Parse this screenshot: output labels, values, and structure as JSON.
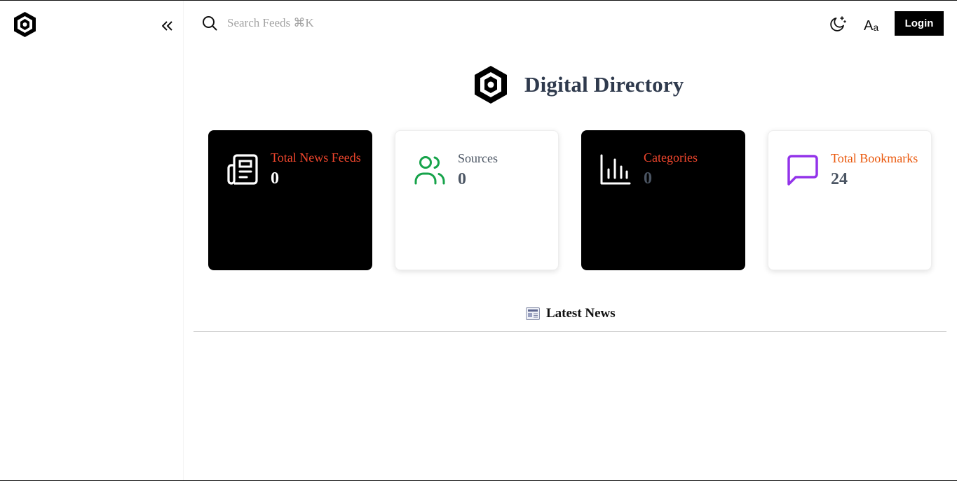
{
  "search": {
    "placeholder": "Search Feeds ⌘K"
  },
  "header": {
    "theme_icon": "moon-sparkle-icon",
    "font_icon": "font-size-icon",
    "font_big": "A",
    "font_small": "a",
    "login_label": "Login"
  },
  "brand": {
    "title": "Digital Directory"
  },
  "stats": [
    {
      "label": "Total News Feeds",
      "value": "0",
      "icon": "newspaper-icon",
      "bg": "#000000",
      "label_color": "#f0462d",
      "value_color": "#ffffff",
      "icon_color": "#ffffff"
    },
    {
      "label": "Sources",
      "value": "0",
      "icon": "users-icon",
      "bg": "#ffffff",
      "label_color": "#4b5563",
      "value_color": "#4b5563",
      "icon_color": "#16a34a"
    },
    {
      "label": "Categories",
      "value": "0",
      "icon": "bar-chart-icon",
      "bg": "#000000",
      "label_color": "#f0462d",
      "value_color": "#4b5563",
      "icon_color": "#ffffff"
    },
    {
      "label": "Total Bookmarks",
      "value": "24",
      "icon": "message-square-icon",
      "bg": "#ffffff",
      "label_color": "#ea580c",
      "value_color": "#4b5563",
      "icon_color": "#9333ea"
    }
  ],
  "latest": {
    "title": "Latest News",
    "icon": "newspaper-emoji-icon"
  }
}
